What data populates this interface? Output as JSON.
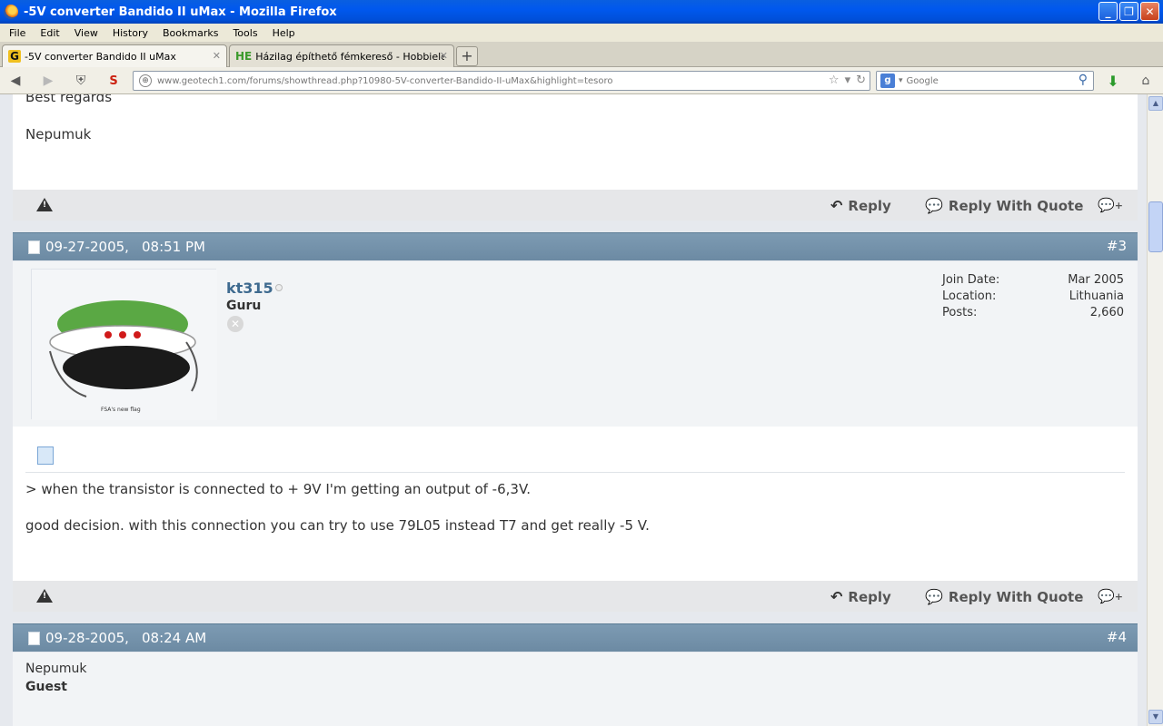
{
  "window": {
    "title": "-5V converter Bandido II uMax - Mozilla Firefox",
    "minimize_glyph": "_",
    "maximize_glyph": "❐",
    "close_glyph": "✕"
  },
  "menu": [
    "File",
    "Edit",
    "View",
    "History",
    "Bookmarks",
    "Tools",
    "Help"
  ],
  "tabs": [
    {
      "favicon": "G",
      "label": "-5V converter Bandido II uMax",
      "active": true
    },
    {
      "favicon": "HE",
      "label": "Házilag építhető fémkereső - Hobbielektr...",
      "active": false
    }
  ],
  "newtab_glyph": "+",
  "nav": {
    "url": "www.geotech1.com/forums/showthread.php?10980-5V-converter-Bandido-II-uMax&highlight=tesoro",
    "search_placeholder": "Google",
    "search_engine_badge": "g"
  },
  "posts": {
    "prev_tail": {
      "line1": "Best regards",
      "signature": "Nepumuk"
    },
    "footer_1": {
      "reply": "Reply",
      "reply_quote": "Reply With Quote"
    },
    "post3": {
      "date": "09-27-2005,",
      "time": "08:51 PM",
      "number": "#3",
      "username": "kt315",
      "usertitle": "Guru",
      "avatar_caption": "FSA's new flag",
      "join_label": "Join Date:",
      "join_value": "Mar 2005",
      "location_label": "Location:",
      "location_value": "Lithuania",
      "posts_label": "Posts:",
      "posts_value": "2,660",
      "line1": "> when the transistor is connected to + 9V I'm getting an output of -6,3V.",
      "line2": "good decision. with this connection you can try to use 79L05 instead T7 and get really -5 V."
    },
    "footer_2": {
      "reply": "Reply",
      "reply_quote": "Reply With Quote"
    },
    "post4": {
      "date": "09-28-2005,",
      "time": "08:24 AM",
      "number": "#4",
      "username": "Nepumuk",
      "usertitle": "Guest"
    }
  },
  "colors": {
    "post_header": "#6c8aa3",
    "username_link": "#3e6a8f",
    "footer_bar": "#e6e7e9",
    "page_bg": "#e6e9ee"
  }
}
